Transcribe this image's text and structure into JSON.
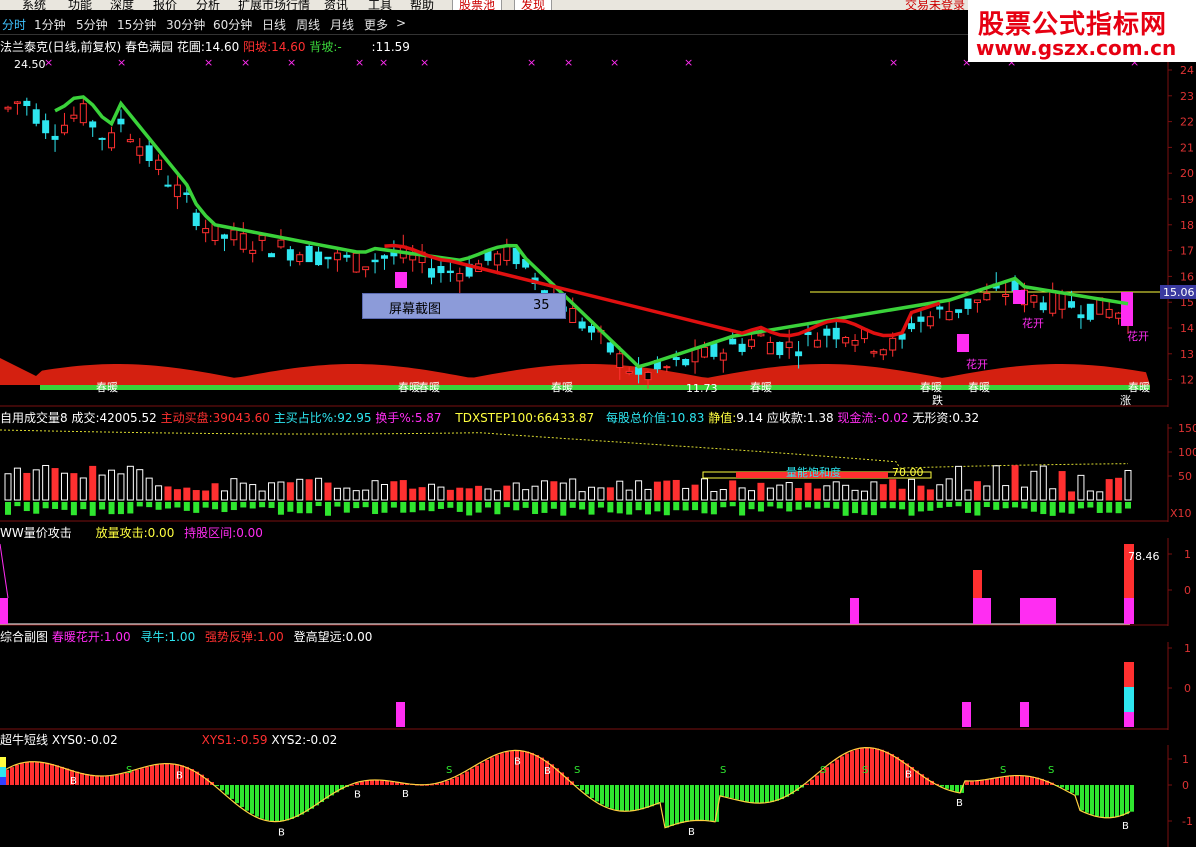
{
  "menubar": {
    "items": [
      "系统",
      "功能",
      "深度",
      "报价",
      "分析",
      "扩展市场行情",
      "资讯",
      "工具",
      "帮助"
    ],
    "pills": [
      "股票池",
      "发现"
    ],
    "right_text": "交易未登录"
  },
  "watermark": {
    "line1": "股票公式指标网",
    "line2": "www.gszx.com.cn"
  },
  "periods": [
    "分时",
    "1分钟",
    "5分钟",
    "15分钟",
    "30分钟",
    "60分钟",
    "日线",
    "周线",
    "月线",
    "更多"
  ],
  "period_more_arrow": ">",
  "main": {
    "title": "法兰泰克(日线,前复权)",
    "indicator_name": "春色满园",
    "hp_label": "花圃:",
    "hp_value": "14.60",
    "yp_label": "阳坡:",
    "yp_value": "14.60",
    "bp_label": "背坡:",
    "bp_value": "-",
    "extra_value": ":11.59",
    "high_label": "24.50",
    "low_label": "11.73",
    "price_tag": "15.06",
    "y_ticks": [
      "24",
      "23",
      "22",
      "21",
      "20",
      "19",
      "18",
      "17",
      "16",
      "15",
      "14",
      "13",
      "12"
    ],
    "labels": {
      "chunnuan": "春暖",
      "huakai": "花开",
      "die": "跌",
      "zhang": "涨"
    }
  },
  "popup": {
    "label": "屏幕截图",
    "value": "35"
  },
  "volume": {
    "name": "自用成交量8",
    "chengjiao_label": "成交:",
    "chengjiao_value": "42005.52",
    "zhudong_label": "主动买盘:",
    "zhudong_value": "39043.60",
    "zhuli_label": "主买占比%:",
    "zhuli_value": "92.95",
    "huanshou_label": "换手%:",
    "huanshou_value": "5.87",
    "tdx_label": "TDXSTEP100:",
    "tdx_value": "66433.87",
    "mgz_label": "每股总价值:",
    "mgz_value": "10.83",
    "jz_label": "静值:",
    "jz_value": "9.14",
    "ysk_label": "应收款:",
    "ysk_value": "1.38",
    "xjl_label": "现金流:",
    "xjl_value": "-0.02",
    "wxz_label": "无形资:",
    "wxz_value": "0.32",
    "y_ticks": [
      "150",
      "100",
      "50"
    ],
    "unit": "X10",
    "bhd_label": "量能饱和度",
    "bhd_value": "70.00"
  },
  "attack": {
    "name": "WW量价攻击",
    "flgj_label": "放量攻击:",
    "flgj_value": "0.00",
    "cgqj_label": "持股区间:",
    "cgqj_value": "0.00",
    "peak_value": "78.46",
    "y_ticks": [
      "1",
      "0"
    ]
  },
  "composite": {
    "name": "综合副图",
    "c1_label": "春暖花开:",
    "c1_value": "1.00",
    "c2_label": "寻牛:",
    "c2_value": "1.00",
    "c3_label": "强势反弹:",
    "c3_value": "1.00",
    "c4_label": "登高望远:",
    "c4_value": "0.00",
    "y_ticks": [
      "1",
      "0"
    ]
  },
  "short": {
    "name": "超牛短线",
    "x0_label": "XYS0:",
    "x0_value": "-0.02",
    "x1_label": "XYS1:",
    "x1_value": "-0.59",
    "x2_label": "XYS2:",
    "x2_value": "-0.02",
    "y_ticks": [
      "1",
      "0",
      "-1"
    ],
    "s_mark": "S",
    "b_mark": "B"
  },
  "colors": {
    "up": "#ff3030",
    "down": "#2ee6f0",
    "ma_green": "#3ad23a",
    "ma_red": "#e01010",
    "magenta": "#ff2df2",
    "grid": "#7a1010"
  }
}
